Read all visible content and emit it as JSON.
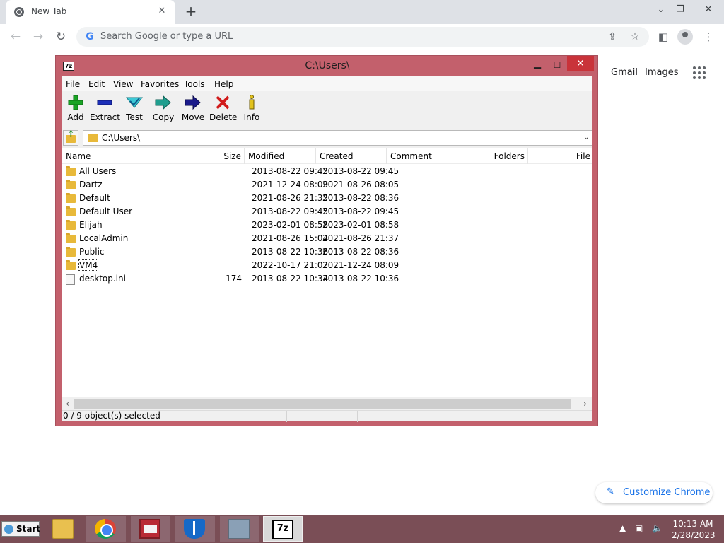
{
  "browser": {
    "tab_title": "New Tab",
    "omnibox_placeholder": "Search Google or type a URL",
    "ntp_links": [
      "Gmail",
      "Images"
    ],
    "customize_label": "Customize Chrome",
    "icons": [
      "chrome-favicon-icon",
      "close-icon",
      "plus-icon",
      "chevron-down-icon",
      "restore-icon",
      "back-icon",
      "forward-icon",
      "reload-icon",
      "google-g-icon",
      "share-icon",
      "star-icon",
      "side-panel-icon",
      "profile-icon",
      "kebab-menu-icon",
      "apps-grid-icon",
      "pencil-icon"
    ]
  },
  "sevenzip": {
    "title": "C:\\Users\\",
    "app_icon_text": "7z",
    "menu": [
      "File",
      "Edit",
      "View",
      "Favorites",
      "Tools",
      "Help"
    ],
    "toolbar": [
      {
        "label": "Add",
        "icon": "add-icon"
      },
      {
        "label": "Extract",
        "icon": "extract-icon"
      },
      {
        "label": "Test",
        "icon": "test-icon"
      },
      {
        "label": "Copy",
        "icon": "copy-icon"
      },
      {
        "label": "Move",
        "icon": "move-icon"
      },
      {
        "label": "Delete",
        "icon": "delete-icon"
      },
      {
        "label": "Info",
        "icon": "info-icon"
      }
    ],
    "path": "C:\\Users\\",
    "columns": [
      "Name",
      "Size",
      "Modified",
      "Created",
      "Comment",
      "Folders",
      "File"
    ],
    "rows": [
      {
        "name": "All Users",
        "size": "",
        "modified": "2013-08-22 09:45",
        "created": "2013-08-22 09:45",
        "type": "folder"
      },
      {
        "name": "Dartz",
        "size": "",
        "modified": "2021-12-24 08:09",
        "created": "2021-08-26 08:05",
        "type": "folder"
      },
      {
        "name": "Default",
        "size": "",
        "modified": "2021-08-26 21:35",
        "created": "2013-08-22 08:36",
        "type": "folder"
      },
      {
        "name": "Default User",
        "size": "",
        "modified": "2013-08-22 09:45",
        "created": "2013-08-22 09:45",
        "type": "folder"
      },
      {
        "name": "Elijah",
        "size": "",
        "modified": "2023-02-01 08:58",
        "created": "2023-02-01 08:58",
        "type": "folder"
      },
      {
        "name": "LocalAdmin",
        "size": "",
        "modified": "2021-08-26 15:04",
        "created": "2021-08-26 21:37",
        "type": "folder"
      },
      {
        "name": "Public",
        "size": "",
        "modified": "2013-08-22 10:36",
        "created": "2013-08-22 08:36",
        "type": "folder"
      },
      {
        "name": "VM4",
        "size": "",
        "modified": "2022-10-17 21:02",
        "created": "2021-12-24 08:09",
        "type": "folder"
      },
      {
        "name": "desktop.ini",
        "size": "174",
        "modified": "2013-08-22 10:34",
        "created": "2013-08-22 10:36",
        "type": "file"
      }
    ],
    "status": "0 / 9 object(s) selected"
  },
  "taskbar": {
    "start_label": "Start",
    "items": [
      "file-explorer-icon",
      "chrome-icon",
      "news-app-icon",
      "security-shield-icon",
      "resource-monitor-icon",
      "7zip-icon"
    ],
    "zip_icon_text": "7z",
    "time": "10:13 AM",
    "date": "2/28/2023"
  }
}
